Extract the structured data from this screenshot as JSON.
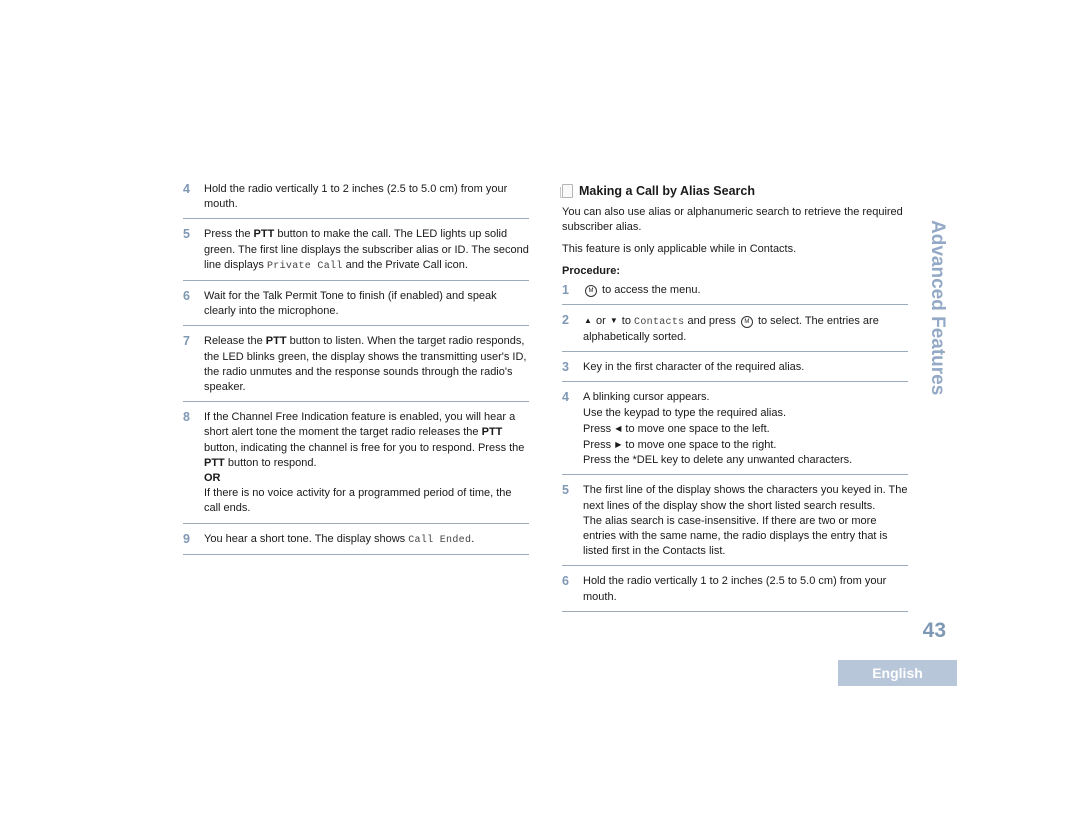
{
  "left_steps": [
    {
      "num": "4",
      "parts": [
        {
          "t": "Hold the radio vertically 1 to 2 inches (2.5 to 5.0 cm) from your mouth."
        }
      ]
    },
    {
      "num": "5",
      "parts": [
        {
          "t": "Press the "
        },
        {
          "t": "PTT",
          "b": true
        },
        {
          "t": " button to make the call. The LED lights up solid green. The first line displays the subscriber alias or ID. The second line displays "
        },
        {
          "t": "Private Call",
          "m": true
        },
        {
          "t": " and the Private Call icon."
        }
      ]
    },
    {
      "num": "6",
      "parts": [
        {
          "t": "Wait for the Talk Permit Tone to finish (if enabled) and speak clearly into the microphone."
        }
      ]
    },
    {
      "num": "7",
      "parts": [
        {
          "t": "Release the "
        },
        {
          "t": "PTT",
          "b": true
        },
        {
          "t": " button to listen. When the target radio responds, the LED blinks green, the display shows the transmitting user's ID, the radio unmutes and the response sounds through the radio's speaker."
        }
      ]
    },
    {
      "num": "8",
      "parts": [
        {
          "t": "If the Channel Free Indication feature is enabled, you will hear a short alert tone the moment the target radio releases the "
        },
        {
          "t": "PTT",
          "b": true
        },
        {
          "t": " button, indicating the channel is free for you to respond. Press the "
        },
        {
          "t": "PTT",
          "b": true
        },
        {
          "t": " button to respond."
        },
        {
          "br": true
        },
        {
          "t": "OR",
          "b": true
        },
        {
          "br": true
        },
        {
          "t": "If there is no voice activity for a programmed period of time, the call ends."
        }
      ]
    },
    {
      "num": "9",
      "parts": [
        {
          "t": "You hear a short tone. The display shows "
        },
        {
          "t": "Call Ended",
          "m": true
        },
        {
          "t": "."
        }
      ]
    }
  ],
  "section": {
    "title": "Making a Call by Alias Search",
    "intro": "You can also use alias or alphanumeric search to retrieve the required subscriber alias.",
    "note": "This feature is only applicable while in Contacts.",
    "procedure_label": "Procedure:"
  },
  "right_steps": [
    {
      "num": "1",
      "parts": [
        {
          "icon": "menu-ok-key-icon",
          "glyph": "®"
        },
        {
          "t": " to access the menu."
        }
      ]
    },
    {
      "num": "2",
      "parts": [
        {
          "icon": "up-arrow-key-icon",
          "glyph": "▲"
        },
        {
          "t": " or "
        },
        {
          "icon": "down-arrow-key-icon",
          "glyph": "▼"
        },
        {
          "t": " to "
        },
        {
          "t": "Contacts",
          "m": true
        },
        {
          "t": " and press "
        },
        {
          "icon": "menu-ok-key-icon",
          "glyph": "®"
        },
        {
          "t": " to select. The entries are alphabetically sorted."
        }
      ]
    },
    {
      "num": "3",
      "parts": [
        {
          "t": "Key in the first character of the required alias."
        }
      ]
    },
    {
      "num": "4",
      "parts": [
        {
          "t": "A blinking cursor appears."
        },
        {
          "br": true
        },
        {
          "t": "Use the keypad to type the required alias."
        },
        {
          "br": true
        },
        {
          "t": "Press "
        },
        {
          "icon": "left-arrow-key-icon",
          "glyph": "◀"
        },
        {
          "t": " to move one space to the left."
        },
        {
          "br": true
        },
        {
          "t": "Press "
        },
        {
          "icon": "right-arrow-key-icon",
          "glyph": "▶"
        },
        {
          "t": " to move one space to the right."
        },
        {
          "br": true
        },
        {
          "t": "Press the *DEL key to delete any unwanted characters."
        }
      ]
    },
    {
      "num": "5",
      "parts": [
        {
          "t": "The first line of the display shows the characters you keyed in. The next lines of the display show the short listed search results."
        },
        {
          "br": true
        },
        {
          "t": "The alias search is case-insensitive. If there are two or more entries with the same name, the radio displays the entry that is listed first in the Contacts list."
        }
      ]
    },
    {
      "num": "6",
      "parts": [
        {
          "t": "Hold the radio vertically 1 to 2 inches (2.5 to 5.0 cm) from your mouth."
        }
      ]
    }
  ],
  "side_tab": "Advanced Features",
  "page_number": "43",
  "language_badge": "English"
}
